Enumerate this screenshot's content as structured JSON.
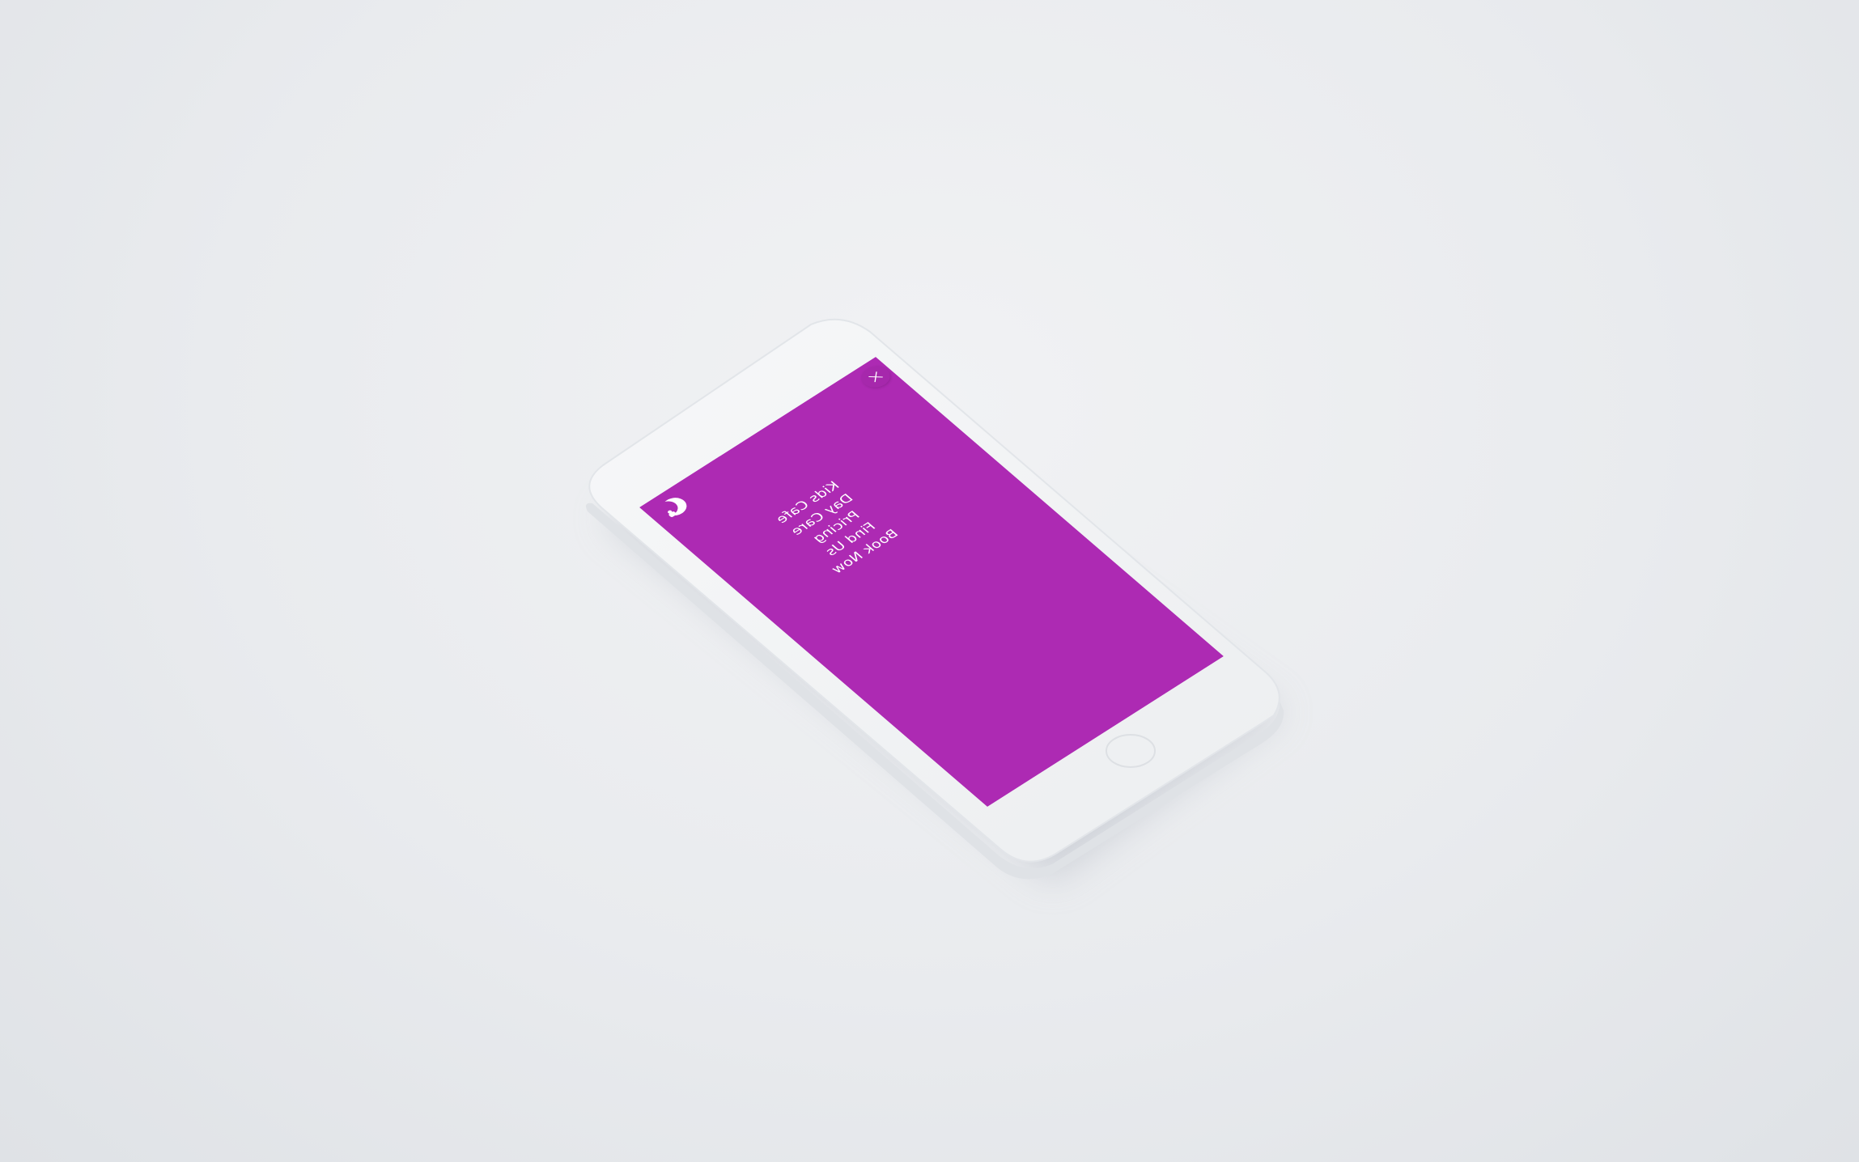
{
  "colors": {
    "background": "#e9ebee",
    "device_body": "#f4f5f6",
    "screen_accent": "#ad2ab3",
    "menu_text": "#ffffff"
  },
  "device": {
    "type": "smartphone-mockup",
    "color": "white"
  },
  "header": {
    "logo_icon": "moon-logo-icon",
    "close_icon": "close-icon"
  },
  "menu": {
    "items": [
      {
        "label": "Kids Cafe"
      },
      {
        "label": "Day Care"
      },
      {
        "label": "Pricing"
      },
      {
        "label": "Find Us"
      },
      {
        "label": "Book Now"
      }
    ]
  }
}
